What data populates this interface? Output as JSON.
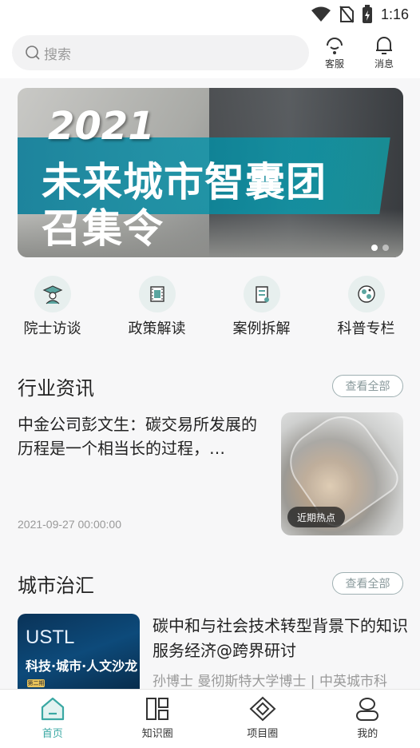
{
  "status": {
    "time": "1:16"
  },
  "search": {
    "placeholder": "搜索"
  },
  "header": {
    "service_label": "客服",
    "message_label": "消息"
  },
  "banner": {
    "year": "2021",
    "line1": "未来城市智囊团",
    "line2": "召集令",
    "page_count": 2,
    "active_page": 1
  },
  "categories": [
    {
      "label": "院士访谈",
      "icon": "scholar-icon"
    },
    {
      "label": "政策解读",
      "icon": "film-icon"
    },
    {
      "label": "案例拆解",
      "icon": "scroll-icon"
    },
    {
      "label": "科普专栏",
      "icon": "globe-icon"
    }
  ],
  "industry": {
    "title": "行业资讯",
    "more": "查看全部",
    "article": {
      "title": "中金公司彭文生：碳交易所发展的历程是一个相当长的过程，…",
      "date": "2021-09-27 00:00:00",
      "badge": "近期热点"
    }
  },
  "city": {
    "title": "城市治汇",
    "more": "查看全部",
    "article": {
      "cover_title": "USTL",
      "cover_subtitle": "科技·城市·人文沙龙",
      "cover_tag": "第二期",
      "title": "碳中和与社会技术转型背景下的知识服务经济@跨界研讨",
      "author": "孙博士 曼彻斯特大学博士 | 中英城市科"
    }
  },
  "tabs": [
    {
      "label": "首页",
      "icon": "home-icon",
      "active": true
    },
    {
      "label": "知识圈",
      "icon": "grid-icon",
      "active": false
    },
    {
      "label": "项目圈",
      "icon": "diamond-icon",
      "active": false
    },
    {
      "label": "我的",
      "icon": "user-icon",
      "active": false
    }
  ],
  "colors": {
    "accent": "#3aa8a3",
    "background": "#f7f7f8"
  }
}
